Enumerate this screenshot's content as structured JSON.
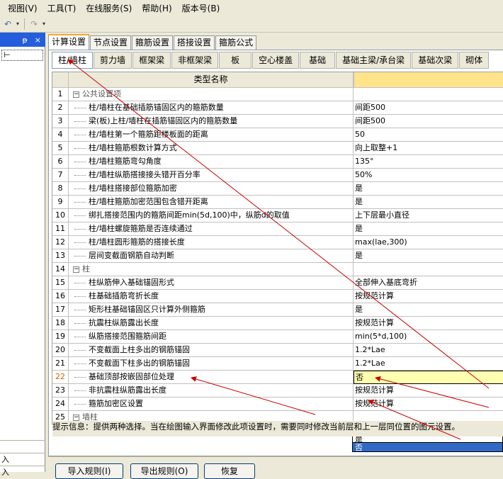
{
  "menubar": {
    "items": [
      "视图(V)",
      "工具(T)",
      "在线服务(S)",
      "帮助(H)",
      "版本号(B)"
    ]
  },
  "toolbar": {
    "icons": [
      "undo-icon",
      "redo-icon"
    ]
  },
  "left_panel": {
    "pin": "ᵽ",
    "close": "×",
    "bottom_items": [
      "",
      "入",
      "入"
    ]
  },
  "tabs_main": [
    "计算设置",
    "节点设置",
    "箍筋设置",
    "搭接设置",
    "箍筋公式"
  ],
  "tabs_sub": [
    "柱/墙柱",
    "剪力墙",
    "框架梁",
    "非框架梁",
    "板",
    "空心楼盖",
    "基础",
    "基础主梁/承台梁",
    "基础次梁",
    "砌体"
  ],
  "grid": {
    "header_name": "类型名称",
    "header_value": "",
    "rows": [
      {
        "num": "1",
        "name": "公共设置项",
        "value": "",
        "group": true
      },
      {
        "num": "2",
        "name": "柱/墙柱在基础插筋锚固区内的箍筋数量",
        "value": "间距500"
      },
      {
        "num": "3",
        "name": "梁(板)上柱/墙柱在插筋锚固区内的箍筋数量",
        "value": "间距500"
      },
      {
        "num": "4",
        "name": "柱/墙柱第一个箍筋距楼板面的距离",
        "value": "50"
      },
      {
        "num": "5",
        "name": "柱/墙柱箍筋根数计算方式",
        "value": "向上取整+1"
      },
      {
        "num": "6",
        "name": "柱/墙柱箍筋弯勾角度",
        "value": "135°"
      },
      {
        "num": "7",
        "name": "柱/墙柱纵筋搭接接头错开百分率",
        "value": "50%"
      },
      {
        "num": "8",
        "name": "柱/墙柱搭接部位箍筋加密",
        "value": "是"
      },
      {
        "num": "9",
        "name": "柱/墙柱箍筋加密范围包含错开距离",
        "value": "是"
      },
      {
        "num": "10",
        "name": "绑扎搭接范围内的箍筋间距min(5d,100)中，纵筋d的取值",
        "value": "上下层最小直径"
      },
      {
        "num": "11",
        "name": "柱/墙柱螺旋箍筋是否连续通过",
        "value": "是"
      },
      {
        "num": "12",
        "name": "柱/墙柱圆形箍筋的搭接长度",
        "value": "max(lae,300)"
      },
      {
        "num": "13",
        "name": "层间变截面钢筋自动判断",
        "value": "是"
      },
      {
        "num": "14",
        "name": "柱",
        "value": "",
        "group": true
      },
      {
        "num": "15",
        "name": "柱纵筋伸入基础锚固形式",
        "value": "全部伸入基底弯折"
      },
      {
        "num": "16",
        "name": "柱基础插筋弯折长度",
        "value": "按规范计算"
      },
      {
        "num": "17",
        "name": "矩形柱基础锚固区只计算外侧箍筋",
        "value": "是"
      },
      {
        "num": "18",
        "name": "抗震柱纵筋露出长度",
        "value": "按规范计算"
      },
      {
        "num": "19",
        "name": "纵筋搭接范围箍筋间距",
        "value": "min(5*d,100)"
      },
      {
        "num": "20",
        "name": "不变截面上柱多出的钢筋锚固",
        "value": "1.2*Lae"
      },
      {
        "num": "21",
        "name": "不变截面下柱多出的钢筋锚固",
        "value": "1.2*Lae"
      },
      {
        "num": "22",
        "name": "基础顶部按嵌固部位处理",
        "value": "否",
        "selected": true
      },
      {
        "num": "23",
        "name": "非抗震柱纵筋露出长度",
        "value": "按规范计算"
      },
      {
        "num": "24",
        "name": "箍筋加密区设置",
        "value": "按规范计算"
      },
      {
        "num": "25",
        "name": "墙柱",
        "value": "",
        "group": true
      }
    ]
  },
  "dropdown": {
    "options": [
      "是",
      "否"
    ],
    "highlighted": "否"
  },
  "hint": "提示信息：提供两种选择。当在绘图输入界面修改此项设置时，需要同时修改当前层和上一层同位置的图元设置。",
  "buttons": {
    "import": "导入规则(I)",
    "export": "导出规则(O)",
    "restore": "恢复"
  },
  "colors": {
    "header_value_bg": "#ffe48c",
    "arrow": "#cc0000",
    "selection": "#316ac5",
    "active_tab_top": "#f7a53c"
  }
}
